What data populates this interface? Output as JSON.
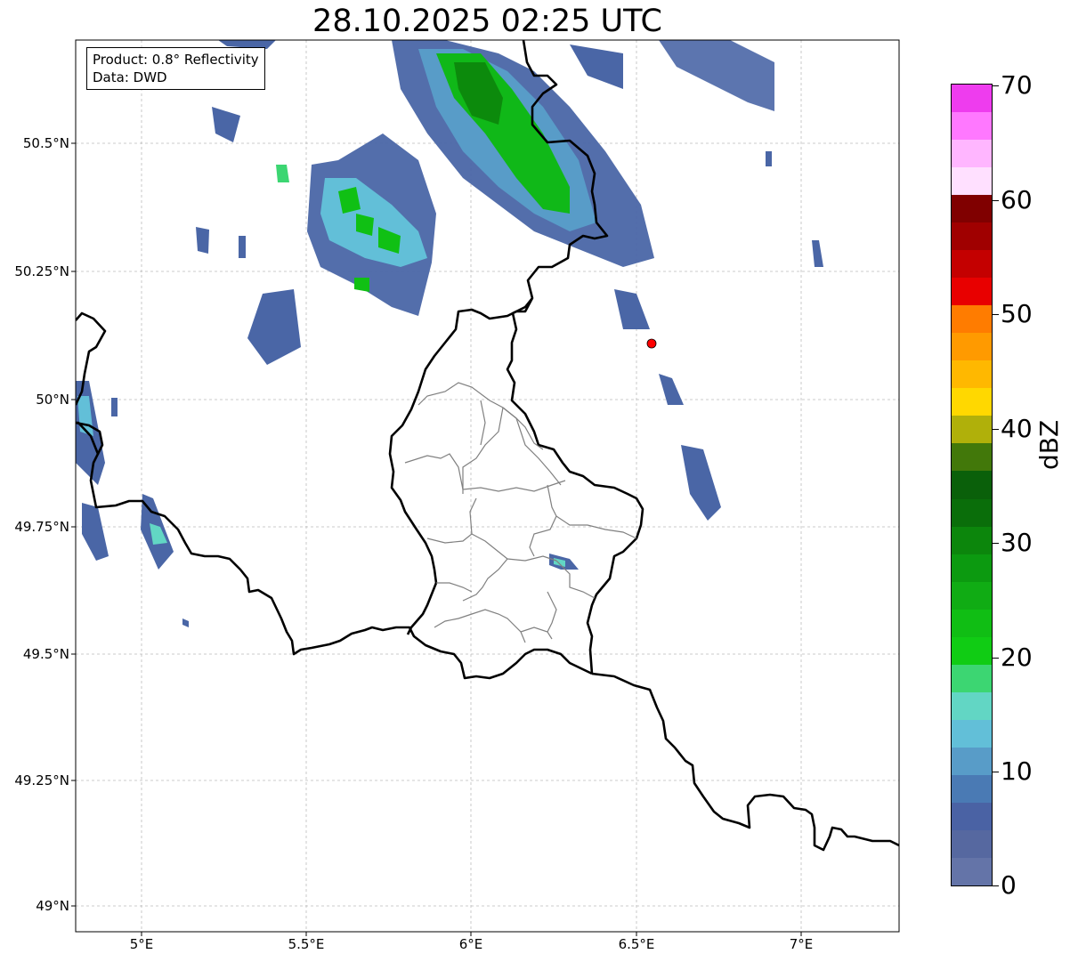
{
  "title": "28.10.2025 02:25 UTC",
  "info": {
    "product": "Product: 0.8° Reflectivity",
    "data": "Data: DWD"
  },
  "lat_labels": [
    "50.5°N",
    "50.25°N",
    "50°N",
    "49.75°N",
    "49.5°N",
    "49.25°N",
    "49°N"
  ],
  "lon_labels": [
    "5°E",
    "5.5°E",
    "6°E",
    "6.5°E",
    "7°E"
  ],
  "colorbar": {
    "unit": "dBZ",
    "ticks": [
      "0",
      "10",
      "20",
      "30",
      "40",
      "50",
      "60",
      "70"
    ],
    "range": [
      0,
      70
    ],
    "step": 2.5,
    "colors": [
      "#6474a8",
      "#5668a0",
      "#4a62a4",
      "#4a7ab4",
      "#589cc8",
      "#62bfd8",
      "#62d6c4",
      "#3cd672",
      "#10cc14",
      "#10be14",
      "#10ac14",
      "#0c9a10",
      "#0c860c",
      "#0a6e0a",
      "#0a600a",
      "#42780a",
      "#b0b00a",
      "#ffd800",
      "#ffb800",
      "#ff9a00",
      "#ff7c00",
      "#e80000",
      "#c40000",
      "#a00000",
      "#800000",
      "#ffe0ff",
      "#ffb6ff",
      "#ff78ff",
      "#ee3cee"
    ]
  },
  "colors": {
    "border": "#000000",
    "district_lines": "#808080",
    "grid": "#bbbbbb",
    "marker": "#ff0000"
  }
}
